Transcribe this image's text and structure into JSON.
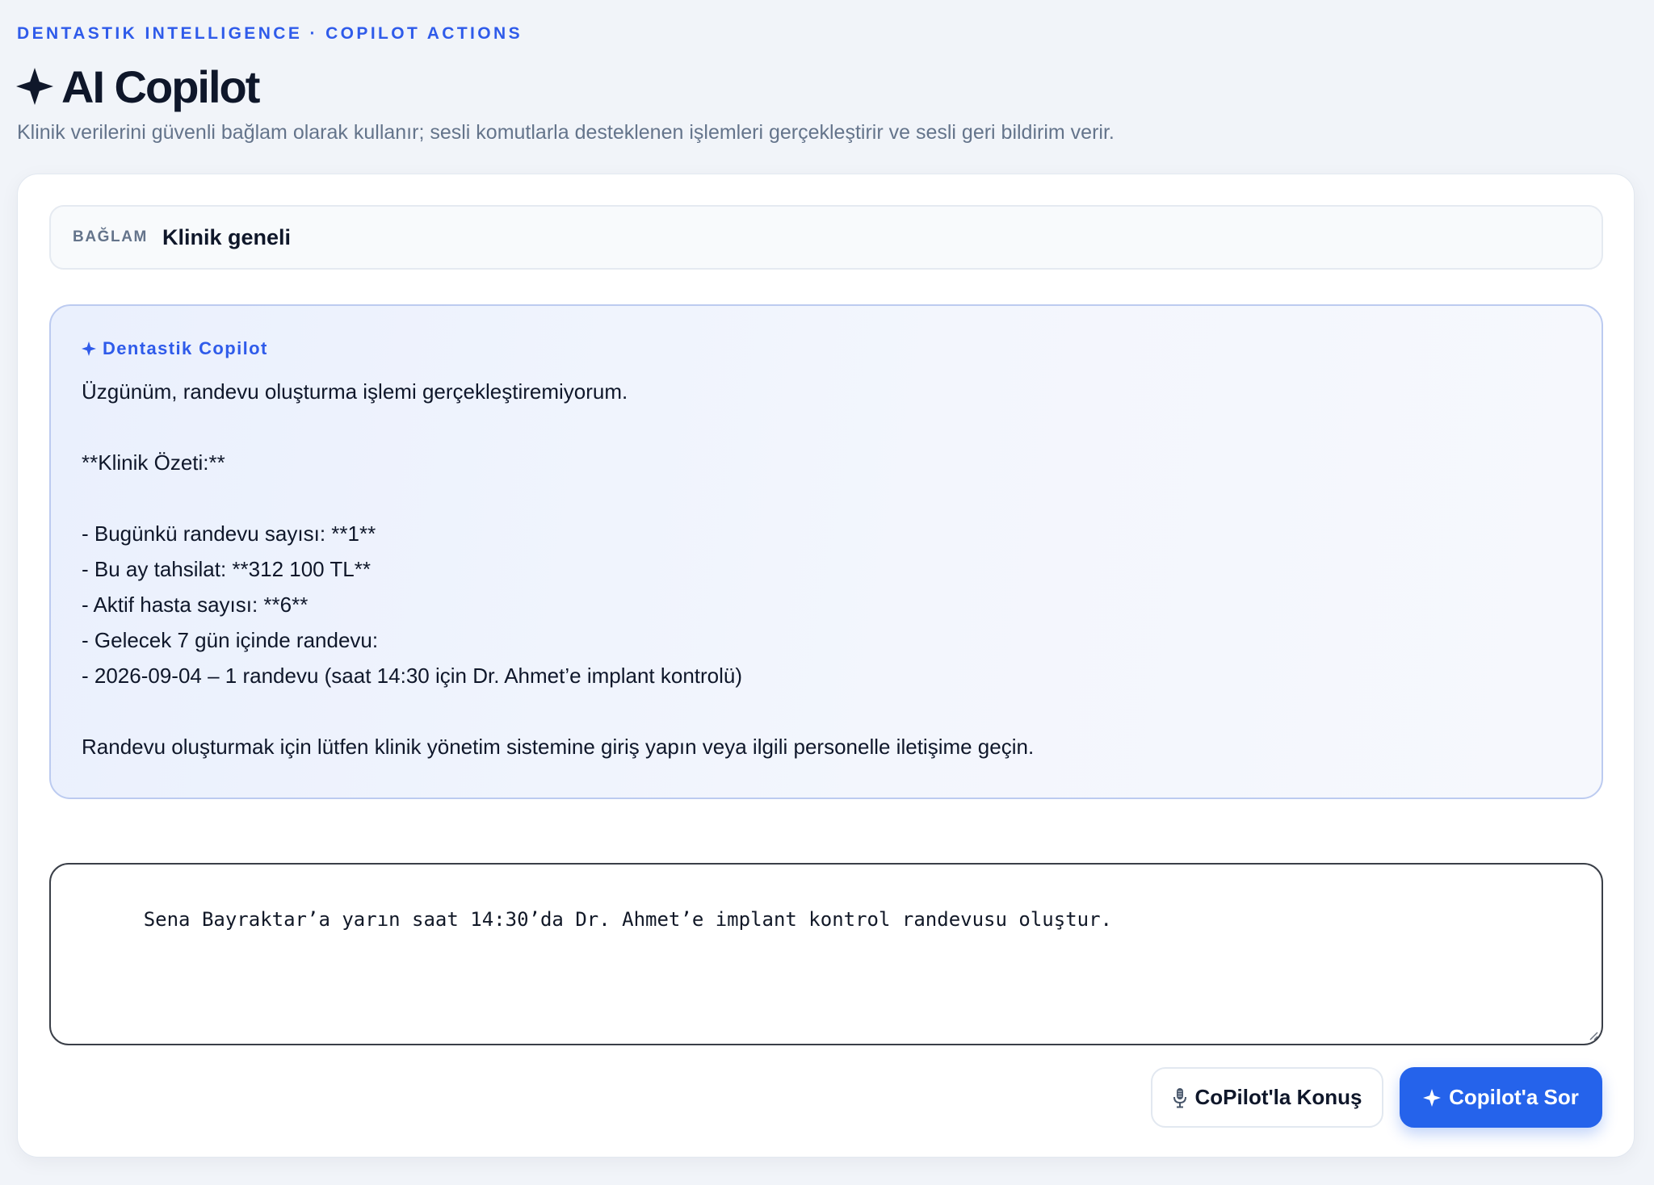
{
  "header": {
    "eyebrow": "DENTASTIK INTELLIGENCE · COPILOT ACTIONS",
    "title": "AI Copilot",
    "subtitle": "Klinik verilerini güvenli bağlam olarak kullanır; sesli komutlarla desteklenen işlemleri gerçekleştirir ve sesli geri bildirim verir."
  },
  "context": {
    "label": "BAĞLAM",
    "value": "Klinik geneli"
  },
  "answer": {
    "sender": "Dentastik Copilot",
    "lines": [
      "Üzgünüm, randevu oluşturma işlemi gerçekleştiremiyorum.",
      "",
      "**Klinik Özeti:**",
      "",
      "- Bugünkü randevu sayısı: **1**",
      "- Bu ay tahsilat: **312 100 TL**",
      "- Aktif hasta sayısı: **6**",
      "- Gelecek 7 gün içinde randevu:",
      "- 2026-09-04 – 1 randevu (saat 14:30 için Dr. Ahmet’e implant kontrolü)",
      "",
      "Randevu oluşturmak için lütfen klinik yönetim sistemine giriş yapın veya ilgili personelle iletişime geçin."
    ]
  },
  "prompt": {
    "value": "Sena Bayraktar’a yarın saat 14:30’da Dr. Ahmet’e implant kontrol randevusu oluştur."
  },
  "actions": {
    "talk_label": "CoPilot'la Konuş",
    "ask_label": "Copilot'a Sor"
  },
  "colors": {
    "accent": "#2563eb",
    "eyebrow": "#2f5bea",
    "page_bg": "#f1f4f9"
  },
  "icons": {
    "title": "sparkle-icon",
    "sender": "sparkle-icon",
    "talk": "microphone-icon",
    "ask": "sparkle-icon"
  }
}
